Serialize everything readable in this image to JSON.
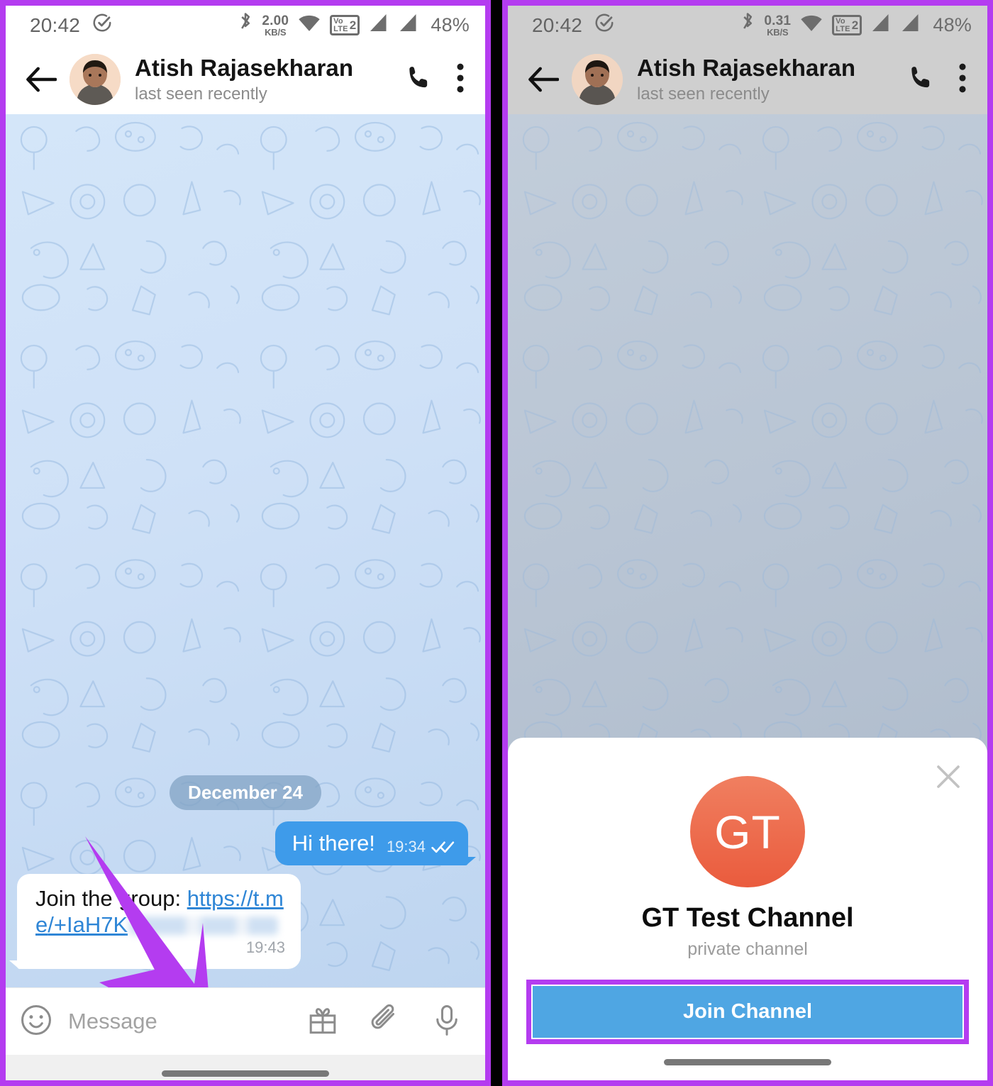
{
  "statusbar": {
    "time": "20:42",
    "clock_icon": "check-clock-icon",
    "bluetooth_icon": "bluetooth-icon",
    "speed_left": "2.00",
    "speed_right": "0.31",
    "speed_unit": "KB/S",
    "wifi_icon": "wifi-icon",
    "volte_vo": "Vo",
    "volte_lte": "LTE",
    "volte_sim": "2",
    "signal_icon": "signal-bars-icon",
    "battery": "48%"
  },
  "header": {
    "back_icon": "back-arrow-icon",
    "avatar": "contact-avatar",
    "name": "Atish Rajasekharan",
    "status": "last seen recently",
    "call_icon": "phone-call-icon",
    "menu_icon": "overflow-menu-icon"
  },
  "chat": {
    "date_chip": "December 24",
    "messages": [
      {
        "direction": "out",
        "text": "Hi there!",
        "time": "19:34",
        "ticks": "double-check-icon"
      },
      {
        "direction": "in",
        "prefix": "Join the group: ",
        "link_line1": "https://t.me",
        "link_line2": "/+IaH7K",
        "redacted": true,
        "time": "19:43"
      }
    ]
  },
  "composer": {
    "emoji_icon": "emoji-smiley-icon",
    "placeholder": "Message",
    "gift_icon": "gift-icon",
    "attach_icon": "paperclip-icon",
    "mic_icon": "microphone-icon"
  },
  "sheet": {
    "close_icon": "close-x-icon",
    "avatar_initials": "GT",
    "title": "GT Test Channel",
    "subtitle": "private channel",
    "join_label": "Join Channel"
  },
  "annotation": {
    "arrow": "callout-arrow",
    "highlight_color": "#b43cf0"
  },
  "colors": {
    "frame_purple": "#b43cf0",
    "outgoing_bubble": "#3e9bea",
    "join_button": "#4fa6e3",
    "gt_avatar_top": "#f07f60",
    "gt_avatar_bottom": "#ea5b3d",
    "link_blue": "#2f86d6"
  }
}
